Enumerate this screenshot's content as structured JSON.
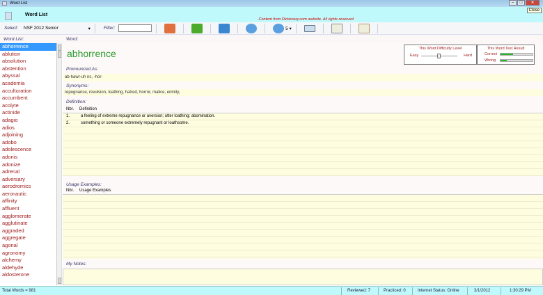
{
  "window": {
    "title": "Word List",
    "close_tooltip": "Close"
  },
  "header": {
    "title": "Word List",
    "copyright": ".Content from Dictionary.com website. All rights reserved"
  },
  "toolbar": {
    "select_label": "Select:",
    "select_value": "NSF 2012 Senior",
    "filter_label": "Filter:",
    "filter_value": "",
    "repeat_value": "5"
  },
  "labels": {
    "word_list": "Word List:",
    "word": "Word:"
  },
  "words": [
    "abhorrence",
    "ablution",
    "absolution",
    "abstention",
    "abyssal",
    "academia",
    "acculturation",
    "accumbent",
    "acolyte",
    "actinide",
    "adagio",
    "adios",
    "adjoining",
    "adobo",
    "adolescence",
    "adonis",
    "adonize",
    "adrenal",
    "adversary",
    "aerodromics",
    "aeronautic",
    "affinity",
    "affluent",
    "agglomerate",
    "agglutinate",
    "aggraded",
    "aggregate",
    "agonal",
    "agronomy",
    "alchemy",
    "aldehyde",
    "aldosterone"
  ],
  "word": {
    "text": "abhorrence",
    "pronounced_label": "Pronounced As:",
    "pronunciation": "ab-hawr-uh ns, -hor-",
    "synonyms_label": "Synonyms:",
    "synonyms": "repugnance, revulsion, loathing, hatred, horror, malice, enmity,",
    "definition_label": "Definition:",
    "def_headers": [
      "Nbr.",
      "Definition"
    ],
    "definitions": [
      {
        "nbr": "1.",
        "text": "a feeling of extreme repugnance or aversion; utter loathing; abomination."
      },
      {
        "nbr": "2.",
        "text": "something or someone extremely repugnant or loathsome."
      }
    ],
    "usage_label": "Usage Examples:",
    "usage_headers": [
      "Nbr.",
      "Usage Examples"
    ],
    "notes_label": "My Notes:"
  },
  "difficulty": {
    "title": "This Word Difficulty Level",
    "easy": "Easy",
    "hard": "Hard",
    "level_fraction": 0.5
  },
  "test_result": {
    "title": "This Word Test Result",
    "correct_label": "Correct",
    "wrong_label": "Wrong",
    "correct_fraction": 0.4,
    "wrong_fraction": 0.2
  },
  "status": {
    "total": "Total Words = 981",
    "reviewed": "Reviewed: 7",
    "practiced": "Practiced: 0",
    "internet": "Internet Status: Online",
    "date": "3/1/2012",
    "time": "1:30:29 PM"
  }
}
